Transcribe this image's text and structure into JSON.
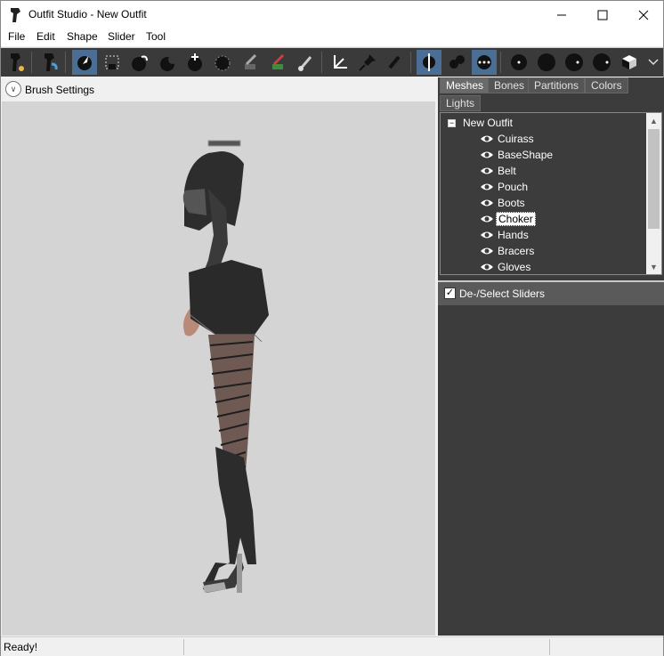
{
  "window": {
    "title": "Outfit Studio - New Outfit"
  },
  "menu": {
    "items": [
      "File",
      "Edit",
      "Shape",
      "Slider",
      "Tool"
    ]
  },
  "toolbar": {
    "buttons": [
      "new-project-icon",
      "load-reference-icon",
      "select-brush-icon",
      "mask-rect-icon",
      "inflate-brush-icon",
      "deflate-brush-icon",
      "move-brush-icon",
      "smooth-brush-icon",
      "undiff-brush-icon",
      "weight-brush-icon",
      "color-brush-icon",
      "alpha-brush-icon",
      "transform-icon",
      "pivot-icon",
      "vertex-edit-icon",
      "symmetry-x-icon",
      "symmetry-y-icon",
      "symmetry-z-icon",
      "brush-size-small-icon",
      "brush-size-medium-icon",
      "brush-size-large-icon",
      "brush-size-xlarge-icon",
      "view-mode-cube-icon",
      "more-options-icon"
    ],
    "active": [
      "select-brush-icon",
      "symmetry-x-icon",
      "symmetry-z-icon"
    ]
  },
  "left": {
    "brush_settings_label": "Brush Settings"
  },
  "tabs": [
    {
      "label": "Meshes",
      "active": true
    },
    {
      "label": "Bones",
      "active": false
    },
    {
      "label": "Partitions",
      "active": false
    },
    {
      "label": "Colors",
      "active": false
    },
    {
      "label": "Lights",
      "active": false
    }
  ],
  "tree": {
    "root": "New Outfit",
    "items": [
      "Cuirass",
      "BaseShape",
      "Belt",
      "Pouch",
      "Boots",
      "Choker",
      "Hands",
      "Bracers",
      "Gloves"
    ],
    "selected": "Choker"
  },
  "sliders": {
    "label": "De-/Select Sliders",
    "checked": true
  },
  "status": {
    "text": "Ready!"
  },
  "colors": {
    "panel_dark": "#3c3c3c",
    "viewport_bg": "#d4d4d4",
    "toolbar_bg": "#3a3a3a",
    "active_blue": "#4a6e94"
  }
}
